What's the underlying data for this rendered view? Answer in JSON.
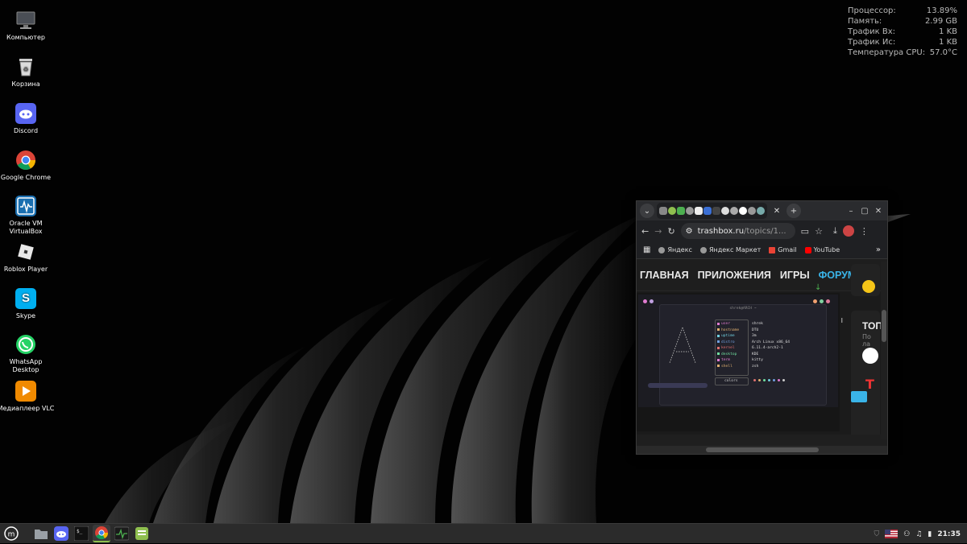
{
  "desktop_icons": [
    {
      "label": "Компьютер",
      "icon": "monitor-icon"
    },
    {
      "label": "Корзина",
      "icon": "trash-icon"
    },
    {
      "label": "Discord",
      "icon": "discord-icon"
    },
    {
      "label": "Google Chrome",
      "icon": "chrome-icon"
    },
    {
      "label": "Oracle VM VirtualBox",
      "icon": "virtualbox-icon"
    },
    {
      "label": "Roblox Player",
      "icon": "roblox-icon"
    },
    {
      "label": "Skype",
      "icon": "skype-icon"
    },
    {
      "label": "WhatsApp Desktop",
      "icon": "whatsapp-icon"
    },
    {
      "label": "Медиаплеер VLC",
      "icon": "vlc-icon"
    }
  ],
  "conky": [
    {
      "label": "Процессор:",
      "value": "13.89%"
    },
    {
      "label": "Память:",
      "value": "2.99 GB"
    },
    {
      "label": "Трафик Вх:",
      "value": "1 KB"
    },
    {
      "label": "Трафик Ис:",
      "value": "1 KB"
    },
    {
      "label": "Температура CPU:",
      "value": "57.0°C"
    }
  ],
  "browser": {
    "url_host": "trashbox.ru",
    "url_path": "/topics/1...",
    "bookmarks": [
      {
        "label": "Яндекс",
        "icon": "globe-icon"
      },
      {
        "label": "Яндекс Маркет",
        "icon": "globe-icon"
      },
      {
        "label": "Gmail",
        "icon": "gmail-icon"
      },
      {
        "label": "YouTube",
        "icon": "youtube-icon"
      }
    ],
    "site_nav": [
      "ГЛАВНАЯ",
      "ПРИЛОЖЕНИЯ",
      "ИГРЫ",
      "ФОРУМ"
    ],
    "site_nav_active": "ФОРУМ",
    "sidebar_heading": "ТОП",
    "sidebar_sub": "По ла",
    "term_title": "shrek@ARCH ~",
    "term_rows": [
      {
        "key": "user",
        "val": "shrek",
        "color": "#e07bd0"
      },
      {
        "key": "hostname",
        "val": "DTU",
        "color": "#e0b070"
      },
      {
        "key": "uptime",
        "val": "3m",
        "color": "#70d0e0"
      },
      {
        "key": "distro",
        "val": "Arch Linux x86_64",
        "color": "#70a0e0"
      },
      {
        "key": "kernel",
        "val": "6.11.4-arch2-1",
        "color": "#e07070"
      },
      {
        "key": "desktop",
        "val": "KDE",
        "color": "#70e0a0"
      },
      {
        "key": "term",
        "val": "kitty",
        "color": "#e07bd0"
      },
      {
        "key": "shell",
        "val": "zsh",
        "color": "#e0b070"
      }
    ],
    "term_colors_label": "colors"
  },
  "taskbar": {
    "apps": [
      "mint-menu-icon",
      "files-icon",
      "discord-icon",
      "terminal-icon",
      "chrome-icon",
      "system-monitor-icon",
      "update-manager-icon"
    ],
    "clock": "21:35"
  },
  "colors": {
    "accent": "#3ab4e8",
    "panel": "#2b2b2b",
    "mint": "#8fbf4f"
  }
}
